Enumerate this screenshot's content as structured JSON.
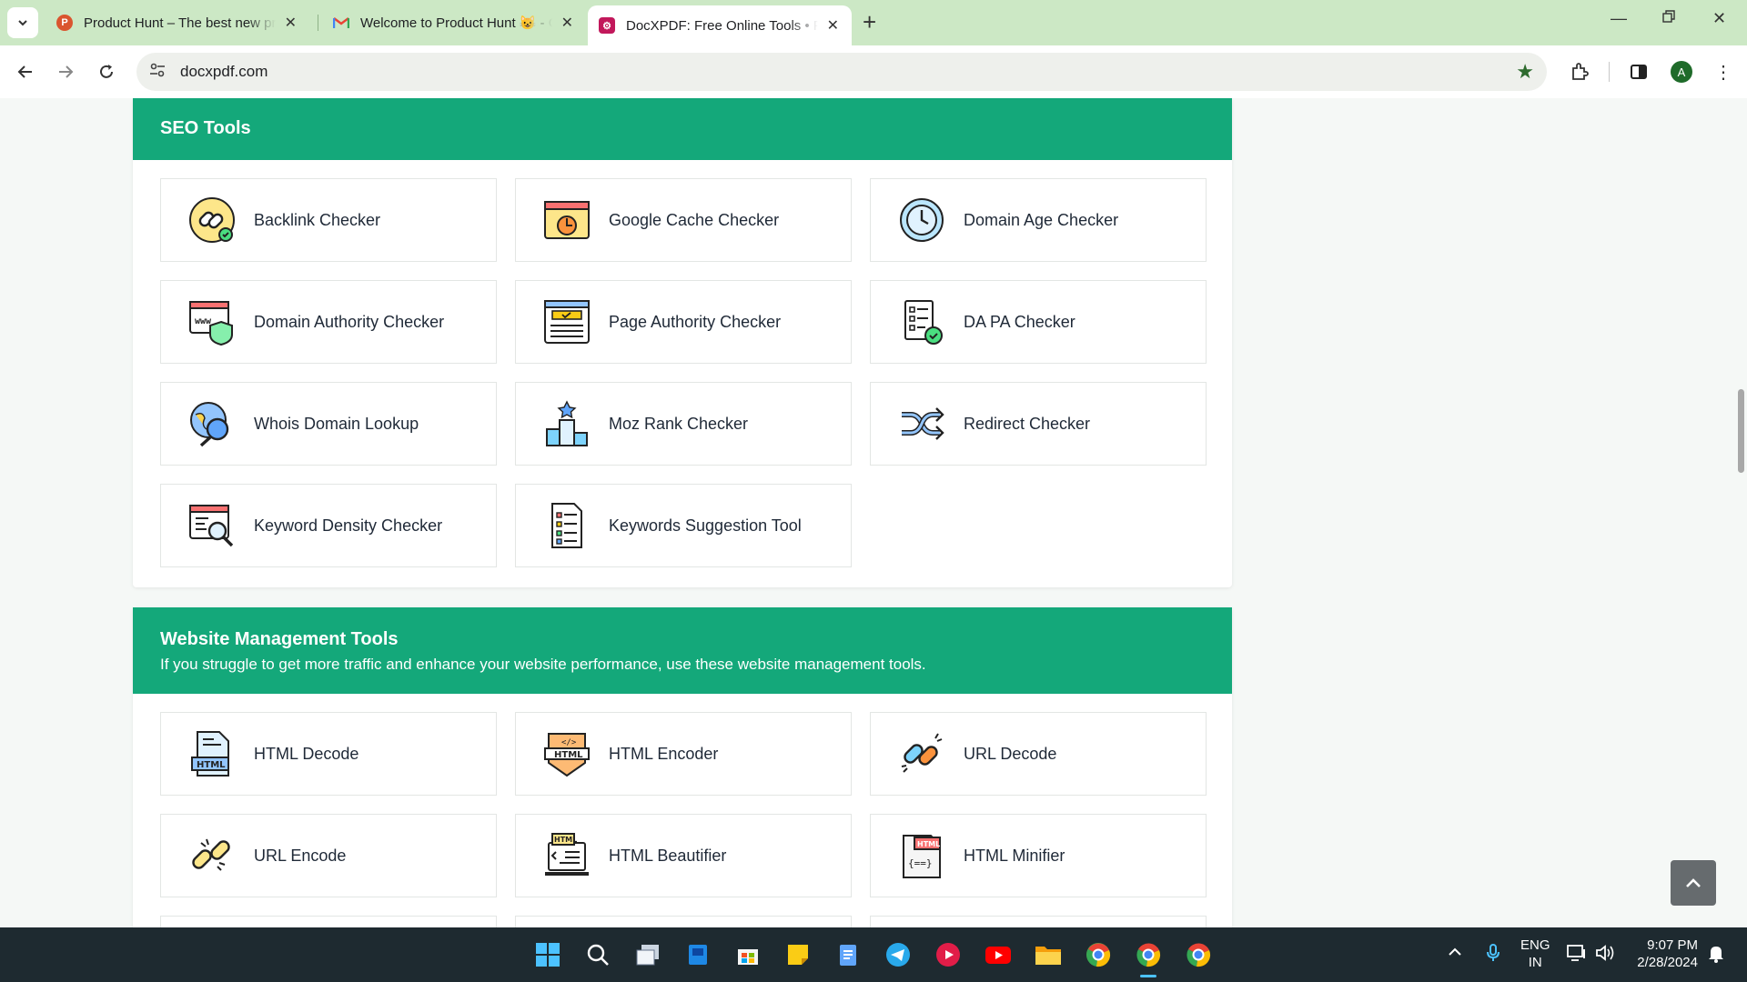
{
  "browser": {
    "tabs": [
      {
        "title": "Product Hunt – The best new products",
        "favicon": "product-hunt-icon"
      },
      {
        "title": "Welcome to Product Hunt 😺 - Gmail",
        "favicon": "gmail-icon"
      },
      {
        "title": "DocXPDF: Free Online Tools • Free",
        "favicon": "docxpdf-icon"
      }
    ],
    "url": "docxpdf.com",
    "profile_initial": "A"
  },
  "seo": {
    "title": "SEO Tools",
    "tools": [
      {
        "label": "Backlink Checker",
        "icon": "backlink-icon"
      },
      {
        "label": "Google Cache Checker",
        "icon": "google-cache-icon"
      },
      {
        "label": "Domain Age Checker",
        "icon": "clock-icon"
      },
      {
        "label": "Domain Authority Checker",
        "icon": "www-shield-icon"
      },
      {
        "label": "Page Authority Checker",
        "icon": "page-window-icon"
      },
      {
        "label": "DA PA Checker",
        "icon": "checklist-icon"
      },
      {
        "label": "Whois Domain Lookup",
        "icon": "globe-search-icon"
      },
      {
        "label": "Moz Rank Checker",
        "icon": "podium-icon"
      },
      {
        "label": "Redirect Checker",
        "icon": "shuffle-icon"
      },
      {
        "label": "Keyword Density Checker",
        "icon": "keyword-search-icon"
      },
      {
        "label": "Keywords Suggestion Tool",
        "icon": "document-list-icon"
      }
    ]
  },
  "website": {
    "title": "Website Management Tools",
    "subtitle": "If you struggle to get more traffic and enhance your website performance, use these website management tools.",
    "tools": [
      {
        "label": "HTML Decode",
        "icon": "html-file-icon"
      },
      {
        "label": "HTML Encoder",
        "icon": "html-badge-icon"
      },
      {
        "label": "URL Decode",
        "icon": "link-icon"
      },
      {
        "label": "URL Encode",
        "icon": "link-broken-icon"
      },
      {
        "label": "HTML Beautifier",
        "icon": "html-monitor-icon"
      },
      {
        "label": "HTML Minifier",
        "icon": "html-code-file-icon"
      }
    ]
  },
  "taskbar": {
    "lang": "ENG",
    "region": "IN",
    "time": "9:07 PM",
    "date": "2/28/2024"
  },
  "colors": {
    "accent": "#14a87a",
    "tabbar": "#cce8c5",
    "taskbar": "#1e2a30"
  }
}
